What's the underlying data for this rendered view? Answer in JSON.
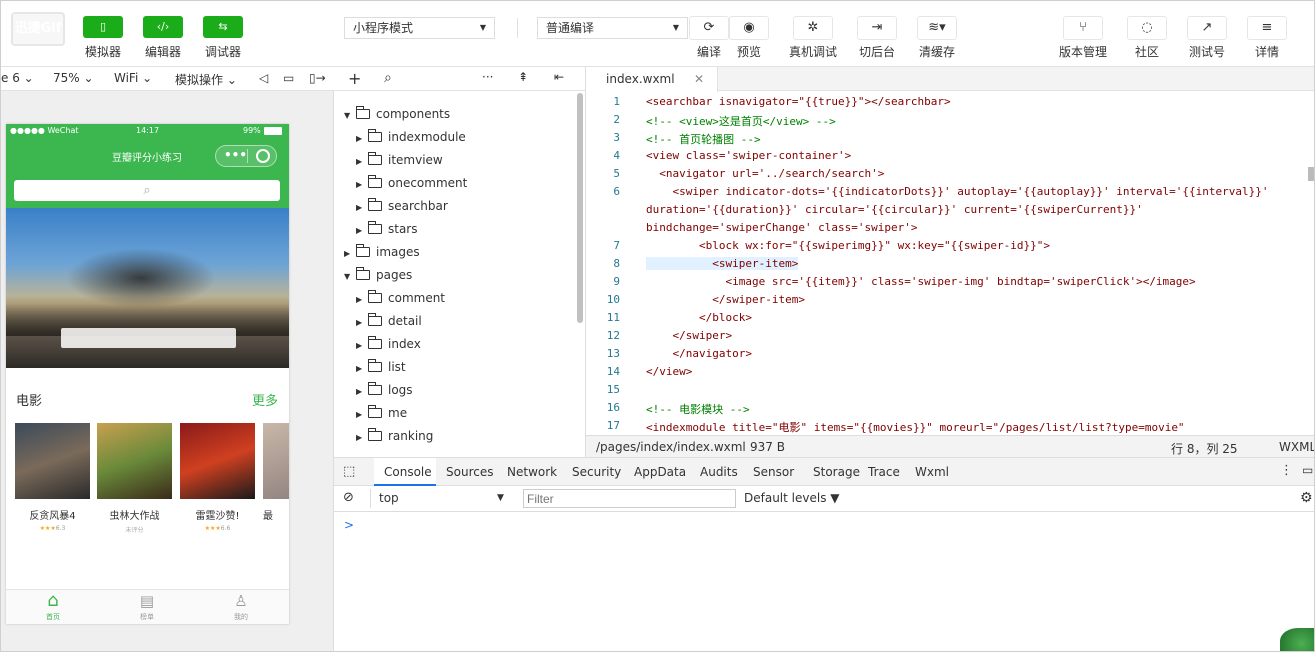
{
  "toolbar": {
    "logo": "迅捷Gif",
    "left_buttons": [
      {
        "label": "模拟器"
      },
      {
        "label": "编辑器"
      },
      {
        "label": "调试器"
      }
    ],
    "mode_select": "小程序模式",
    "compile_select": "普通编译",
    "mid_buttons": [
      {
        "label": "编译"
      },
      {
        "label": "预览"
      },
      {
        "label": "真机调试"
      },
      {
        "label": "切后台"
      },
      {
        "label": "清缓存"
      }
    ],
    "right_buttons": [
      {
        "label": "版本管理"
      },
      {
        "label": "社区"
      },
      {
        "label": "测试号"
      },
      {
        "label": "详情"
      }
    ]
  },
  "simbar": {
    "device": "e 6",
    "zoom": "75%",
    "network": "WiFi",
    "operation": "模拟操作"
  },
  "phone": {
    "carrier": "●●●●● WeChat",
    "time": "14:17",
    "battery": "99%",
    "title": "豆瓣评分小练习",
    "section_title": "电影",
    "more": "更多",
    "movies": [
      {
        "title": "反贪风暴4",
        "rating": "6.3",
        "stars": "★★★"
      },
      {
        "title": "虫林大作战",
        "rating": "",
        "stars": "",
        "note": "未评分"
      },
      {
        "title": "雷霆沙赞!",
        "rating": "6.6",
        "stars": "★★★"
      },
      {
        "title": "最",
        "rating": "",
        "stars": ""
      }
    ],
    "tabs": [
      {
        "label": "首页"
      },
      {
        "label": "榜单"
      },
      {
        "label": "我的"
      }
    ]
  },
  "tree": {
    "nodes": [
      {
        "label": "components",
        "open": true,
        "depth": 0
      },
      {
        "label": "indexmodule",
        "open": false,
        "depth": 1
      },
      {
        "label": "itemview",
        "open": false,
        "depth": 1
      },
      {
        "label": "onecomment",
        "open": false,
        "depth": 1
      },
      {
        "label": "searchbar",
        "open": false,
        "depth": 1
      },
      {
        "label": "stars",
        "open": false,
        "depth": 1
      },
      {
        "label": "images",
        "open": false,
        "depth": 0
      },
      {
        "label": "pages",
        "open": true,
        "depth": 0
      },
      {
        "label": "comment",
        "open": false,
        "depth": 1
      },
      {
        "label": "detail",
        "open": false,
        "depth": 1
      },
      {
        "label": "index",
        "open": false,
        "depth": 1
      },
      {
        "label": "list",
        "open": false,
        "depth": 1
      },
      {
        "label": "logs",
        "open": false,
        "depth": 1
      },
      {
        "label": "me",
        "open": false,
        "depth": 1
      },
      {
        "label": "ranking",
        "open": false,
        "depth": 1
      }
    ]
  },
  "editor": {
    "tab": "index.wxml",
    "lines": [
      {
        "n": "1",
        "text": "<searchbar isnavigator=\"{{true}}\"></searchbar>"
      },
      {
        "n": "2",
        "text": "<!-- <view>这是首页</view> -->"
      },
      {
        "n": "3",
        "text": "<!-- 首页轮播图 -->"
      },
      {
        "n": "4",
        "text": "<view class='swiper-container'>"
      },
      {
        "n": "5",
        "text": "  <navigator url='../search/search'>"
      },
      {
        "n": "6",
        "text": "    <swiper indicator-dots='{{indicatorDots}}' autoplay='{{autoplay}}' interval='{{interval}}'"
      },
      {
        "n": "",
        "text": "duration='{{duration}}' circular='{{circular}}' current='{{swiperCurrent}}'"
      },
      {
        "n": "",
        "text": "bindchange='swiperChange' class='swiper'>"
      },
      {
        "n": "7",
        "text": "        <block wx:for=\"{{swiperimg}}\" wx:key=\"{{swiper-id}}\">"
      },
      {
        "n": "8",
        "text": "          <swiper-item>"
      },
      {
        "n": "9",
        "text": "            <image src='{{item}}' class='swiper-img' bindtap='swiperClick'></image>"
      },
      {
        "n": "10",
        "text": "          </swiper-item>"
      },
      {
        "n": "11",
        "text": "        </block>"
      },
      {
        "n": "12",
        "text": "    </swiper>"
      },
      {
        "n": "13",
        "text": "    </navigator>"
      },
      {
        "n": "14",
        "text": "</view>"
      },
      {
        "n": "15",
        "text": ""
      },
      {
        "n": "16",
        "text": "<!-- 电影模块 -->"
      },
      {
        "n": "17",
        "text": "<indexmodule title=\"电影\" items=\"{{movies}}\" moreurl=\"/pages/list/list?type=movie\""
      }
    ],
    "status_path": "/pages/index/index.wxml",
    "status_size": "937 B",
    "status_pos": "行 8，列 25",
    "status_lang": "WXML"
  },
  "console": {
    "tabs": [
      {
        "label": "Console"
      },
      {
        "label": "Sources"
      },
      {
        "label": "Network"
      },
      {
        "label": "Security"
      },
      {
        "label": "AppData"
      },
      {
        "label": "Audits"
      },
      {
        "label": "Sensor"
      },
      {
        "label": "Storage"
      },
      {
        "label": "Trace"
      },
      {
        "label": "Wxml"
      }
    ],
    "context": "top",
    "filter_placeholder": "Filter",
    "levels": "Default levels",
    "prompt": ">"
  }
}
